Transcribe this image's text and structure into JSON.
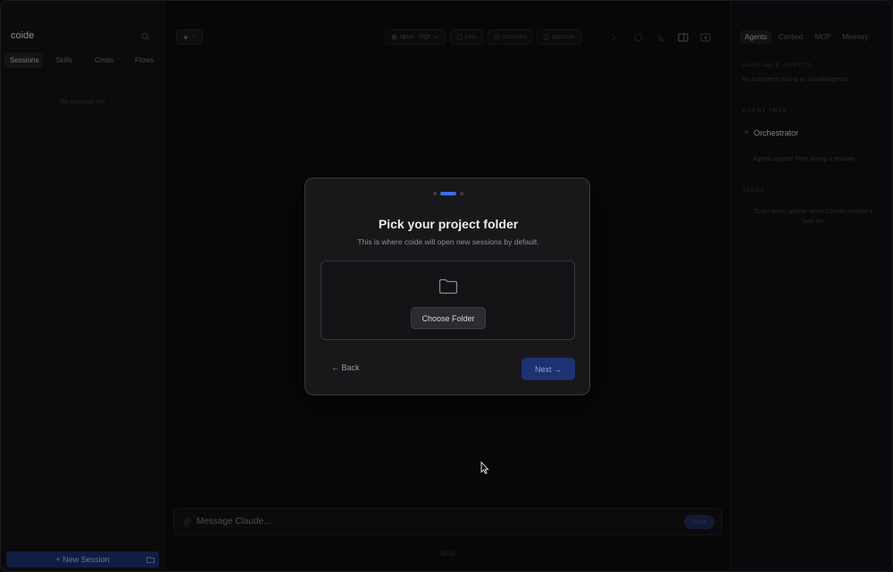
{
  "app": {
    "title": "coide"
  },
  "sidebar": {
    "tabs": [
      {
        "label": "Sessions",
        "active": true
      },
      {
        "label": "Skills",
        "active": false
      },
      {
        "label": "Cmds",
        "active": false
      },
      {
        "label": "Flows",
        "active": false
      }
    ],
    "empty_title": "No sessions yet",
    "empty_hint": "",
    "new_session_label": "+ New Session"
  },
  "main": {
    "mode_pill": "~",
    "toolbar": {
      "model_label": "opus · high",
      "plan_label": "plan",
      "compact_label": "compact",
      "approve_label": "approve"
    },
    "composer": {
      "placeholder": "Message Claude...",
      "send_label": "Send"
    },
    "footer_model": "opus"
  },
  "right_panel": {
    "tabs": [
      {
        "label": "Agents",
        "active": true
      },
      {
        "label": "Context",
        "active": false
      },
      {
        "label": "MCP",
        "active": false
      },
      {
        "label": "Memory",
        "active": false
      }
    ],
    "available_agents_heading": "AVAILABLE AGENTS",
    "no_subagents_text": "No subagents found in .claude/agents/",
    "agent_tree_heading": "AGENT TREE",
    "orchestrator_label": "Orchestrator",
    "agents_hint": "Agents appear here during a session",
    "tasks_heading": "TASKS",
    "tasks_hint_line1": "Tasks items appear when Claude creates a",
    "tasks_hint_line2": "task list"
  },
  "modal": {
    "steps": [
      false,
      true,
      false
    ],
    "title": "Pick your project folder",
    "subtitle": "This is where coide will open new sessions by default.",
    "choose_label": "Choose Folder",
    "back_label": "← Back",
    "next_label": "Next →"
  },
  "colors": {
    "accent": "#3d6ce6",
    "next_button": "#1e3272",
    "new_session": "#1a2d63",
    "traffic_red": "#ff5f57",
    "traffic_yellow": "#febc2e",
    "traffic_green": "#28c840"
  }
}
